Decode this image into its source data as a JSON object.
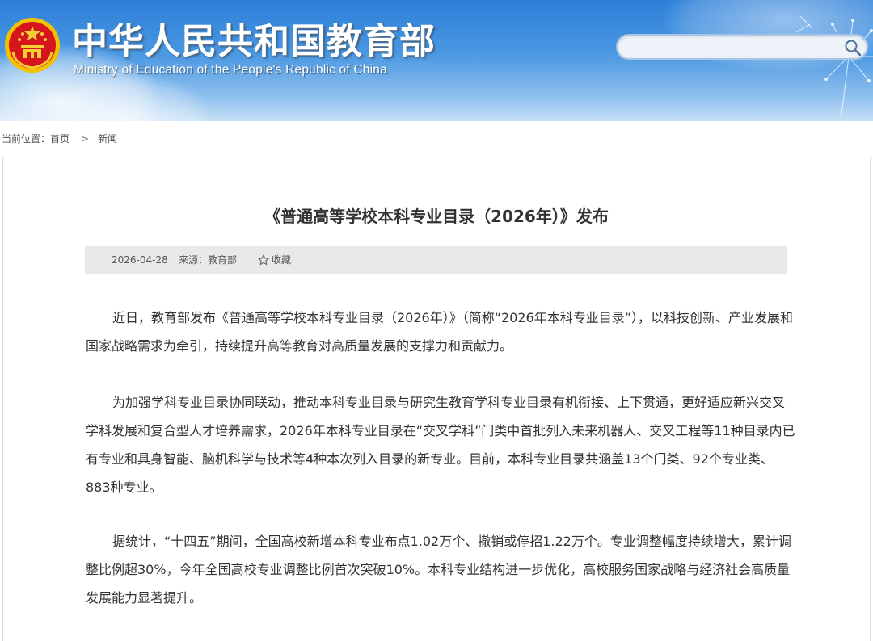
{
  "header": {
    "site_title": "中华人民共和国教育部",
    "site_subtitle": "Ministry of Education of the People's Republic of China",
    "emblem_icon": "national-emblem-icon",
    "search": {
      "placeholder": "",
      "value": "",
      "icon": "search-icon"
    }
  },
  "breadcrumb": {
    "label": "当前位置：",
    "items": [
      "首页",
      "新闻"
    ],
    "separator": ">"
  },
  "article": {
    "title": "《普通高等学校本科专业目录（2026年）》发布",
    "date": "2026-04-28",
    "source": "来源：教育部",
    "favorite": "收藏",
    "favorite_icon": "star-icon",
    "paragraphs": [
      "近日，教育部发布《普通高等学校本科专业目录（2026年）》（简称“2026年本科专业目录”），以科技创新、产业发展和国家战略需求为牵引，持续提升高等教育对高质量发展的支撑力和贡献力。",
      "为加强学科专业目录协同联动，推动本科专业目录与研究生教育学科专业目录有机衔接、上下贯通，更好适应新兴交叉学科发展和复合型人才培养需求，2026年本科专业目录在“交叉学科”门类中首批列入未来机器人、交叉工程等11种目录内已有专业和具身智能、脑机科学与技术等4种本次列入目录的新专业。目前，本科专业目录共涵盖13个门类、92个专业类、883种专业。",
      "据统计，“十四五”期间，全国高校新增本科专业布点1.02万个、撤销或停招1.22万个。专业调整幅度持续增大，累计调整比例超30%，今年全国高校专业调整比例首次突破10%。本科专业结构进一步优化，高校服务国家战略与经济社会高质量发展能力显著提升。"
    ]
  },
  "colors": {
    "banner_top": "#2c7fd9",
    "banner_bottom": "#c7e0f6",
    "meta_bar": "#e9e9e9",
    "text": "#333333"
  }
}
